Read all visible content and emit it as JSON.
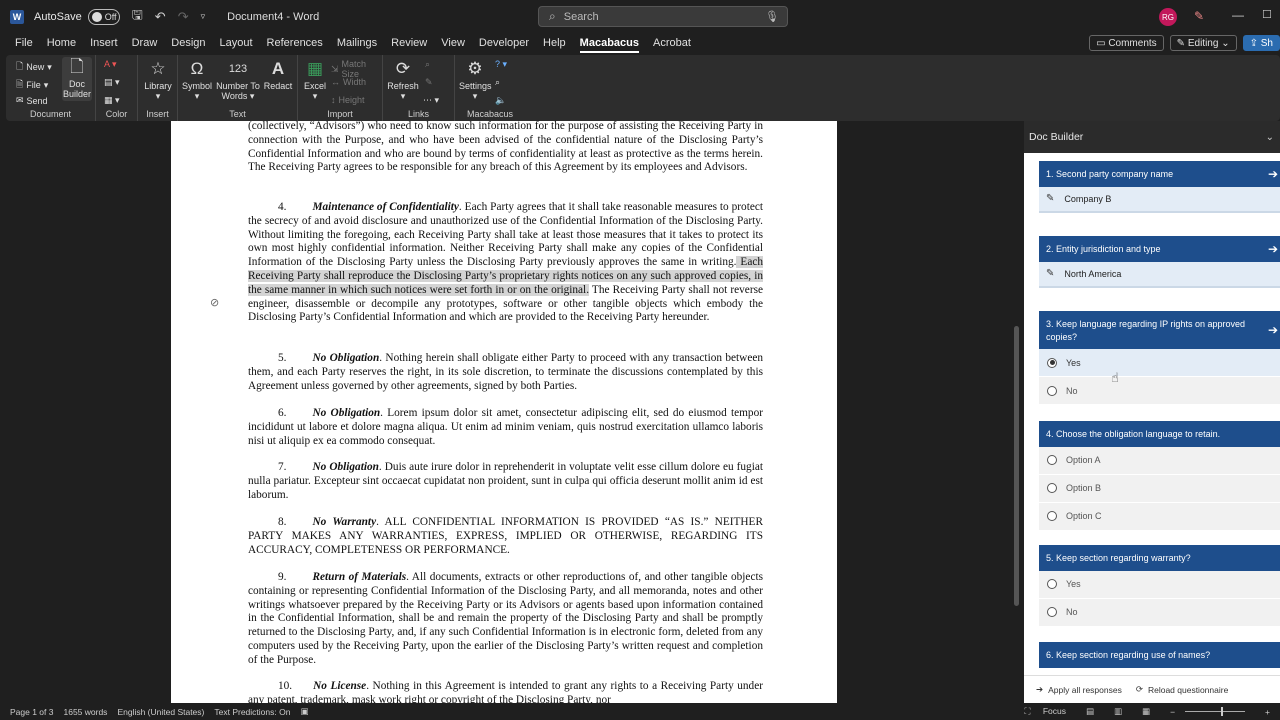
{
  "titlebar": {
    "autosave_label": "AutoSave",
    "toggle_state": "Off",
    "doc_title": "Document4  -  Word",
    "search_placeholder": "Search",
    "avatar_initials": "RG"
  },
  "menu": {
    "tabs": [
      "File",
      "Home",
      "Insert",
      "Draw",
      "Design",
      "Layout",
      "References",
      "Mailings",
      "Review",
      "View",
      "Developer",
      "Help",
      "Macabacus",
      "Acrobat"
    ],
    "active": "Macabacus",
    "comments": "Comments",
    "editing": "Editing",
    "share": "Sh"
  },
  "ribbon": {
    "document": {
      "label": "Document",
      "new": "New",
      "file": "File",
      "send": "Send",
      "doc_builder_1": "Doc",
      "doc_builder_2": "Builder"
    },
    "color": {
      "label": "Color"
    },
    "insert": {
      "label": "Insert",
      "library": "Library"
    },
    "text": {
      "label": "Text",
      "symbol": "Symbol",
      "number_to_words_1": "Number To",
      "number_to_words_2": "Words",
      "redact": "Redact"
    },
    "import": {
      "label": "Import",
      "excel": "Excel",
      "match_size": "Match Size",
      "width": "Width",
      "height": "Height"
    },
    "links": {
      "label": "Links",
      "refresh": "Refresh"
    },
    "macabacus": {
      "label": "Macabacus",
      "settings": "Settings"
    }
  },
  "document": {
    "p0": "(collectively, “Advisors”) who need to know such information for the purpose of assisting the Receiving Party in connection with the Purpose, and who have been advised of the confidential nature of the Disclosing Party’s Confidential Information and who are bound by terms of confidentiality at least as protective as the terms herein.  The Receiving Party agrees to be responsible for any breach of this Agreement by its employees and Advisors.",
    "p4_num": "4.",
    "p4_title": "Maintenance of Confidentiality",
    "p4_a": ".  Each Party agrees that it shall take reasonable measures to protect the secrecy of and avoid disclosure and unauthorized use of the Confidential Information of the Disclosing Party.  Without limiting the foregoing, each Receiving Party shall take at least those measures that it takes to protect its own most highly confidential information.  Neither Receiving Party shall make any copies of the Confidential Information of the Disclosing Party unless the Disclosing Party previously approves the same in writing.",
    "p4_hl": " Each Receiving Party shall reproduce the Disclosing Party’s proprietary rights notices on any such approved copies, in the same manner in which such notices were set forth in or on the original.",
    "p4_b": "  The Receiving Party shall not reverse engineer, disassemble or decompile any prototypes, software or other tangible objects which embody the Disclosing Party’s Confidential Information and which are provided to the Receiving Party hereunder.",
    "p5_num": "5.",
    "p5_title": "No Obligation",
    "p5_text": ".  Nothing herein shall obligate either Party to proceed with any transaction between them, and each Party reserves the right, in its sole discretion, to terminate the discussions contemplated by this Agreement unless governed by other agreements, signed by both Parties.",
    "p6_num": "6.",
    "p6_title": "No Obligation",
    "p6_text": ".  Lorem ipsum dolor sit amet, consectetur adipiscing elit, sed do eiusmod tempor incididunt ut labore et dolore magna aliqua. Ut enim ad minim veniam, quis nostrud exercitation ullamco laboris nisi ut aliquip ex ea commodo consequat.",
    "p7_num": "7.",
    "p7_title": "No Obligation",
    "p7_text": ".  Duis aute irure dolor in reprehenderit in voluptate velit esse cillum dolore eu fugiat nulla pariatur. Excepteur sint occaecat cupidatat non proident, sunt in culpa qui officia deserunt mollit anim id est laborum.",
    "p8_num": "8.",
    "p8_title": "No Warranty",
    "p8_text": ".  ALL CONFIDENTIAL INFORMATION IS PROVIDED “AS IS.” NEITHER PARTY MAKES ANY WARRANTIES, EXPRESS, IMPLIED OR OTHERWISE, REGARDING ITS ACCURACY, COMPLETENESS OR PERFORMANCE.",
    "p9_num": "9.",
    "p9_title": "Return of Materials",
    "p9_text": ".  All documents, extracts or other reproductions of, and other tangible objects containing or representing Confidential Information of the Disclosing Party, and all memoranda, notes and other writings whatsoever prepared by the Receiving Party or its Advisors or agents based upon information contained in the Confidential Information, shall be and remain the property of the Disclosing Party and shall be promptly returned to the Disclosing Party, and, if any such Confidential Information is in electronic form, deleted from any computers used by the Receiving Party, upon the earlier of the Disclosing Party’s written request and completion of the Purpose.",
    "p10_num": "10.",
    "p10_title": "No License",
    "p10_text": ".  Nothing in this Agreement is intended to grant any rights to a Receiving Party under any patent, trademark, mask work right or copyright of the Disclosing Party, nor"
  },
  "status": {
    "page": "Page 1 of 3",
    "words": "1655 words",
    "language": "English (United States)",
    "predictions": "Text Predictions: On",
    "focus": "Focus"
  },
  "pane": {
    "title": "Doc Builder",
    "q1": {
      "label": "1. Second party company name",
      "answer": "Company B"
    },
    "q2": {
      "label": "2. Entity jurisdiction and type",
      "answer": "North America"
    },
    "q3": {
      "label": "3. Keep language regarding IP rights on approved copies?",
      "opt1": "Yes",
      "opt2": "No"
    },
    "q4": {
      "label": "4. Choose the obligation language to retain.",
      "opt1": "Option A",
      "opt2": "Option B",
      "opt3": "Option C"
    },
    "q5": {
      "label": "5. Keep section regarding warranty?",
      "opt1": "Yes",
      "opt2": "No"
    },
    "q6": {
      "label": "6. Keep section regarding use of names?"
    },
    "apply_all": "Apply all responses",
    "reload": "Reload questionnaire"
  },
  "colors": {
    "accent": "#1e4e8c",
    "word_blue": "#2b579a"
  }
}
